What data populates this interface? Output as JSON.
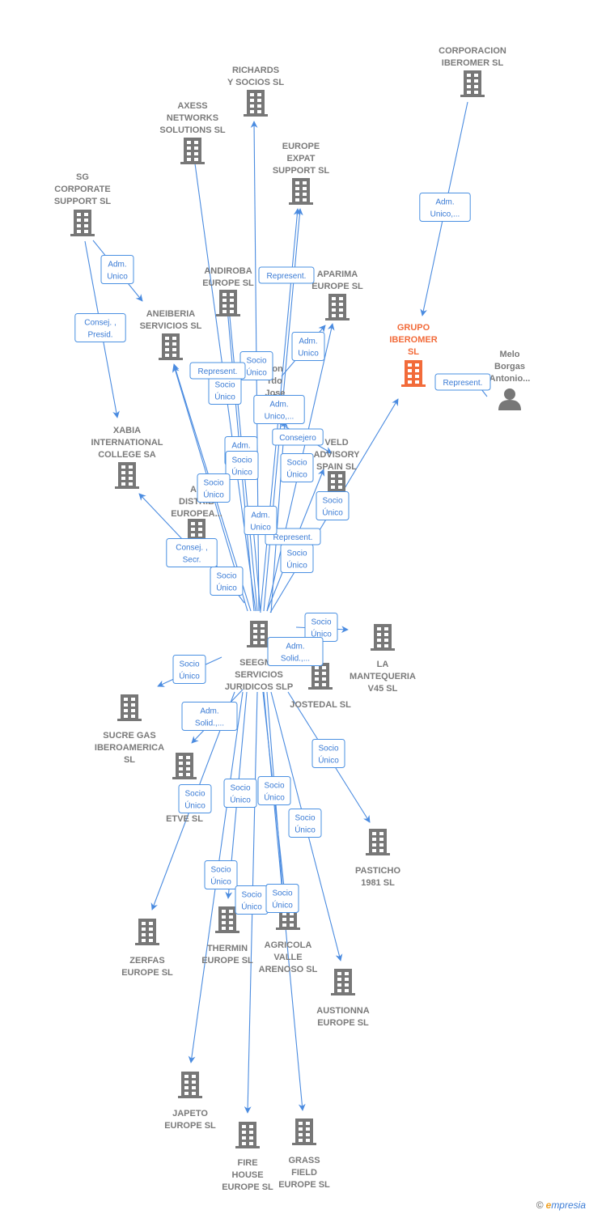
{
  "colors": {
    "company": "#777777",
    "highlight": "#f26b3a",
    "edge": "#4a8be0",
    "label": "#3a7bd5"
  },
  "nodes": [
    {
      "id": "corporacion-iberomer",
      "type": "company",
      "lines": [
        "CORPORACION",
        "IBEROMER  SL"
      ]
    },
    {
      "id": "richards",
      "type": "company",
      "lines": [
        "RICHARDS",
        "Y SOCIOS  SL"
      ]
    },
    {
      "id": "axess",
      "type": "company",
      "lines": [
        "AXESS",
        "NETWORKS",
        "SOLUTIONS  SL"
      ]
    },
    {
      "id": "europe-expat",
      "type": "company",
      "lines": [
        "EUROPE",
        "EXPAT",
        "SUPPORT  SL"
      ]
    },
    {
      "id": "sg-corporate",
      "type": "company",
      "lines": [
        "SG",
        "CORPORATE",
        "SUPPORT  SL"
      ]
    },
    {
      "id": "andiroba",
      "type": "company",
      "lines": [
        "ANDIROBA",
        "EUROPE  SL"
      ]
    },
    {
      "id": "aneiberia",
      "type": "company",
      "lines": [
        "ANEIBERIA",
        "SERVICIOS  SL"
      ]
    },
    {
      "id": "aparima",
      "type": "company",
      "lines": [
        "APARIMA",
        "EUROPE  SL"
      ]
    },
    {
      "id": "grupo-iberomer",
      "type": "company",
      "highlight": true,
      "lines": [
        "GRUPO",
        "IBEROMER",
        "SL"
      ]
    },
    {
      "id": "melo-borgas",
      "type": "person",
      "lines": [
        "Melo",
        "Borgas",
        "Antonio..."
      ]
    },
    {
      "id": "leon",
      "type": "person",
      "lines": [
        "eon",
        "rdo",
        "Jose"
      ]
    },
    {
      "id": "xabia",
      "type": "company",
      "lines": [
        "XABIA",
        "INTERNATIONAL",
        "COLLEGE SA"
      ]
    },
    {
      "id": "veld",
      "type": "company",
      "lines": [
        "VELD",
        "ADVISORY",
        "SPAIN  SL"
      ]
    },
    {
      "id": "ar-distrib",
      "type": "company",
      "lines": [
        "AR",
        "DISTRIB",
        "EUROPEA..."
      ]
    },
    {
      "id": "seegma",
      "type": "company",
      "lines": [
        "SEEGMA",
        "SERVICIOS",
        "JURIDICOS  SLP"
      ]
    },
    {
      "id": "la-mantequeria",
      "type": "company",
      "lines": [
        "LA",
        "MANTEQUERIA",
        "V45  SL"
      ]
    },
    {
      "id": "jostedal",
      "type": "company",
      "lines": [
        "JOSTEDAL  SL"
      ]
    },
    {
      "id": "sucre-gas",
      "type": "company",
      "lines": [
        "SUCRE GAS",
        "IBEROAMERICA",
        "SL"
      ]
    },
    {
      "id": "vi-gl-etve",
      "type": "company",
      "lines": [
        "VI",
        "GL",
        "ETVE  SL"
      ]
    },
    {
      "id": "pasticho",
      "type": "company",
      "lines": [
        "PASTICHO",
        "1981  SL"
      ]
    },
    {
      "id": "zerfas",
      "type": "company",
      "lines": [
        "ZERFAS",
        "EUROPE  SL"
      ]
    },
    {
      "id": "thermin",
      "type": "company",
      "lines": [
        "THERMIN",
        "EUROPE  SL"
      ]
    },
    {
      "id": "agricola",
      "type": "company",
      "lines": [
        "AGRICOLA",
        "VALLE",
        "ARENOSO  SL"
      ]
    },
    {
      "id": "austionna",
      "type": "company",
      "lines": [
        "AUSTIONNA",
        "EUROPE  SL"
      ]
    },
    {
      "id": "japeto",
      "type": "company",
      "lines": [
        "JAPETO",
        "EUROPE  SL"
      ]
    },
    {
      "id": "fire-house",
      "type": "company",
      "lines": [
        "FIRE",
        "HOUSE",
        "EUROPE  SL"
      ]
    },
    {
      "id": "grass-field",
      "type": "company",
      "lines": [
        "GRASS",
        "FIELD",
        "EUROPE  SL"
      ]
    }
  ],
  "edges": [
    {
      "from": 0,
      "to": 8,
      "label": "Adm.\nUnico,..."
    },
    {
      "from": 9,
      "to": 8,
      "label": "Represent."
    },
    {
      "from": 4,
      "to": 6,
      "label": "Adm.\nUnico"
    },
    {
      "from": 4,
      "to": 11,
      "label": "Consej. ,\nPresid."
    },
    {
      "from": 14,
      "to": 1,
      "label": "Socio\nÚnico"
    },
    {
      "from": 14,
      "to": 2,
      "label": "Socio\nÚnico"
    },
    {
      "from": 14,
      "to": 3,
      "label": "Represent."
    },
    {
      "from": 14,
      "to": 3,
      "label": "Adm.\nUnico,..."
    },
    {
      "from": 14,
      "to": 5,
      "label": "Adm.\nUnico"
    },
    {
      "from": 14,
      "to": 5,
      "label": "Socio\nÚnico"
    },
    {
      "from": 10,
      "to": 7,
      "label": "Adm.\nUnico"
    },
    {
      "from": 14,
      "to": 6,
      "label": "Represent."
    },
    {
      "from": 14,
      "to": 6,
      "label": "Socio\nÚnico"
    },
    {
      "from": 14,
      "to": 7,
      "label": "Socio\nÚnico"
    },
    {
      "from": 14,
      "to": 12,
      "label": "Consejero"
    },
    {
      "from": 14,
      "to": 12,
      "label": "Socio\nÚnico"
    },
    {
      "from": 14,
      "to": 8,
      "label": "Socio\nÚnico"
    },
    {
      "from": 14,
      "to": 10,
      "label": "Represent."
    },
    {
      "from": 14,
      "to": 13,
      "label": "Adm.\nUnico"
    },
    {
      "from": 13,
      "to": 11,
      "label": "Consej. ,\nSecr."
    },
    {
      "from": 14,
      "to": 13,
      "label": "Socio\nÚnico"
    },
    {
      "from": 14,
      "to": 15,
      "label": "Socio\nÚnico"
    },
    {
      "from": 14,
      "to": 16,
      "label": "Adm.\nSolid.,..."
    },
    {
      "from": 14,
      "to": 17,
      "label": "Socio\nÚnico"
    },
    {
      "from": 14,
      "to": 18,
      "label": "Adm.\nSolid.,..."
    },
    {
      "from": 14,
      "to": 19,
      "label": "Socio\nÚnico"
    },
    {
      "from": 14,
      "to": 20,
      "label": "Socio\nÚnico"
    },
    {
      "from": 14,
      "to": 21,
      "label": "Socio\nÚnico"
    },
    {
      "from": 14,
      "to": 22,
      "label": "Socio\nÚnico"
    },
    {
      "from": 14,
      "to": 23,
      "label": "Socio\nÚnico"
    },
    {
      "from": 14,
      "to": 24,
      "label": "Socio\nÚnico"
    },
    {
      "from": 14,
      "to": 25,
      "label": "Socio\nÚnico"
    },
    {
      "from": 14,
      "to": 22,
      "label": "Socio\nÚnico"
    },
    {
      "from": 14,
      "to": 26,
      "label": "Socio\nÚnico"
    }
  ],
  "footer": {
    "copyright": "©",
    "brand_initial": "e",
    "brand_rest": "mpresia"
  }
}
